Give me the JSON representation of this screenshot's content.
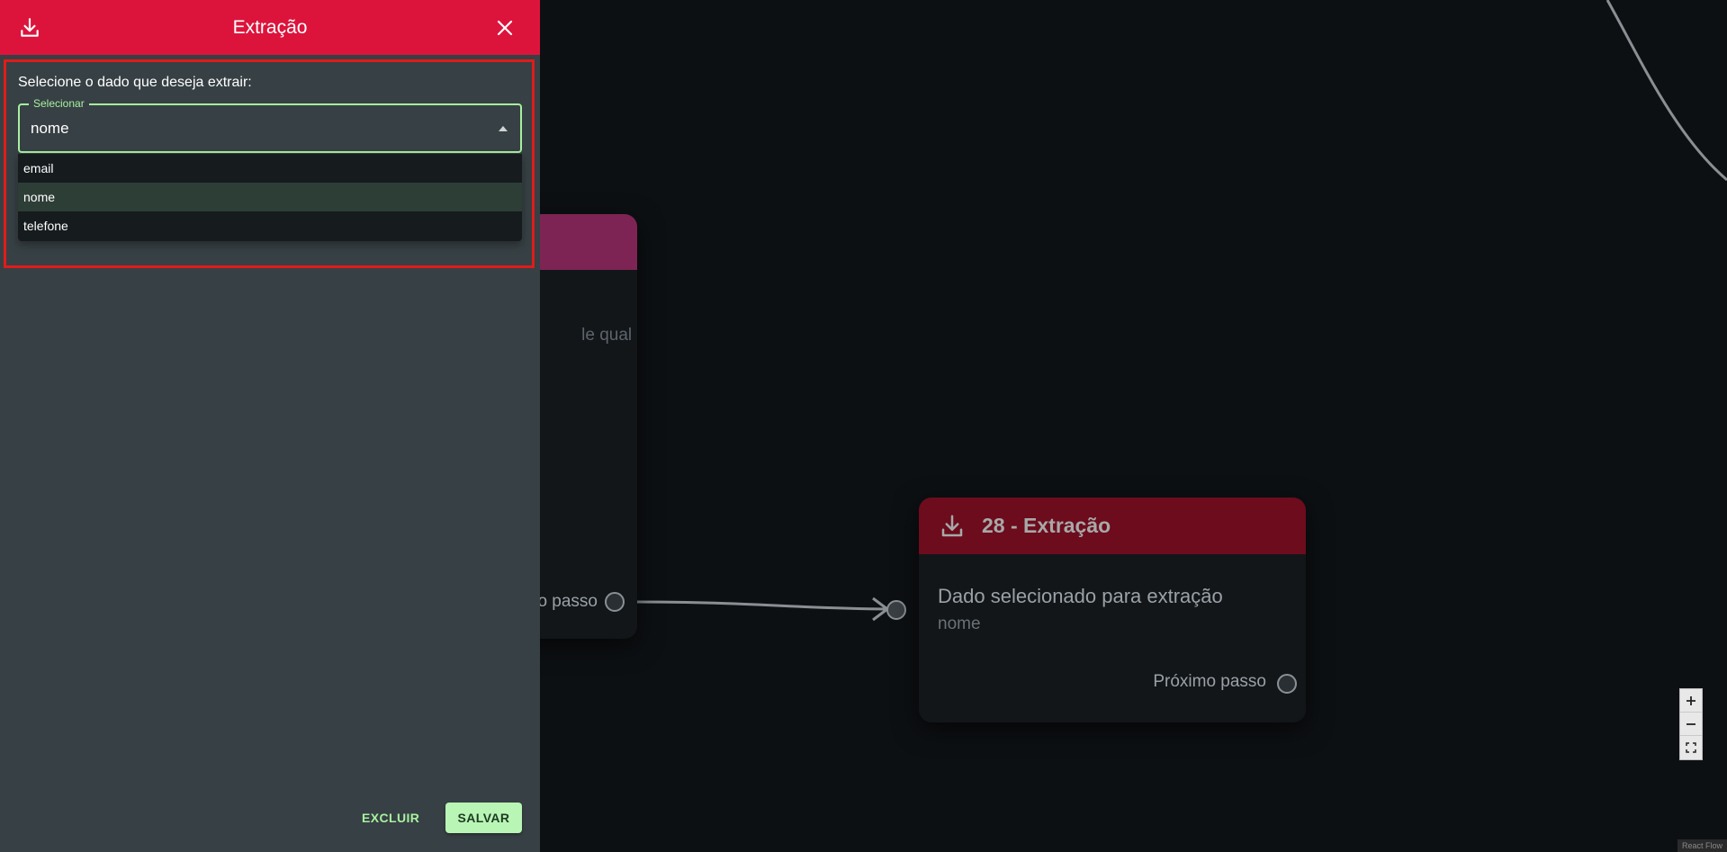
{
  "panel": {
    "title": "Extração",
    "header_icon": "download-icon",
    "close_icon": "close-icon",
    "prompt": "Selecione o dado que deseja extrair:",
    "select": {
      "label": "Selecionar",
      "value": "nome",
      "options": [
        "email",
        "nome",
        "telefone"
      ]
    },
    "delete_label": "EXCLUIR",
    "save_label": "SALVAR"
  },
  "nodes": {
    "previous": {
      "snippet": "le qual é",
      "next_label": "o passo"
    },
    "extraction": {
      "title": "28 - Extração",
      "body_title": "Dado selecionado para extração",
      "body_value": "nome",
      "next_label": "Próximo passo"
    }
  },
  "controls": {
    "zoom_in": "plus-icon",
    "zoom_out": "minus-icon",
    "fit": "fit-view-icon"
  },
  "attribution": "React Flow",
  "colors": {
    "panel_header": "#dc143c",
    "panel_bg": "#374044",
    "accent": "#a8f0a0",
    "canvas_bg": "#0d1013",
    "node_header_previous": "#7d2454",
    "node_header_extraction": "#6c0c1d"
  }
}
